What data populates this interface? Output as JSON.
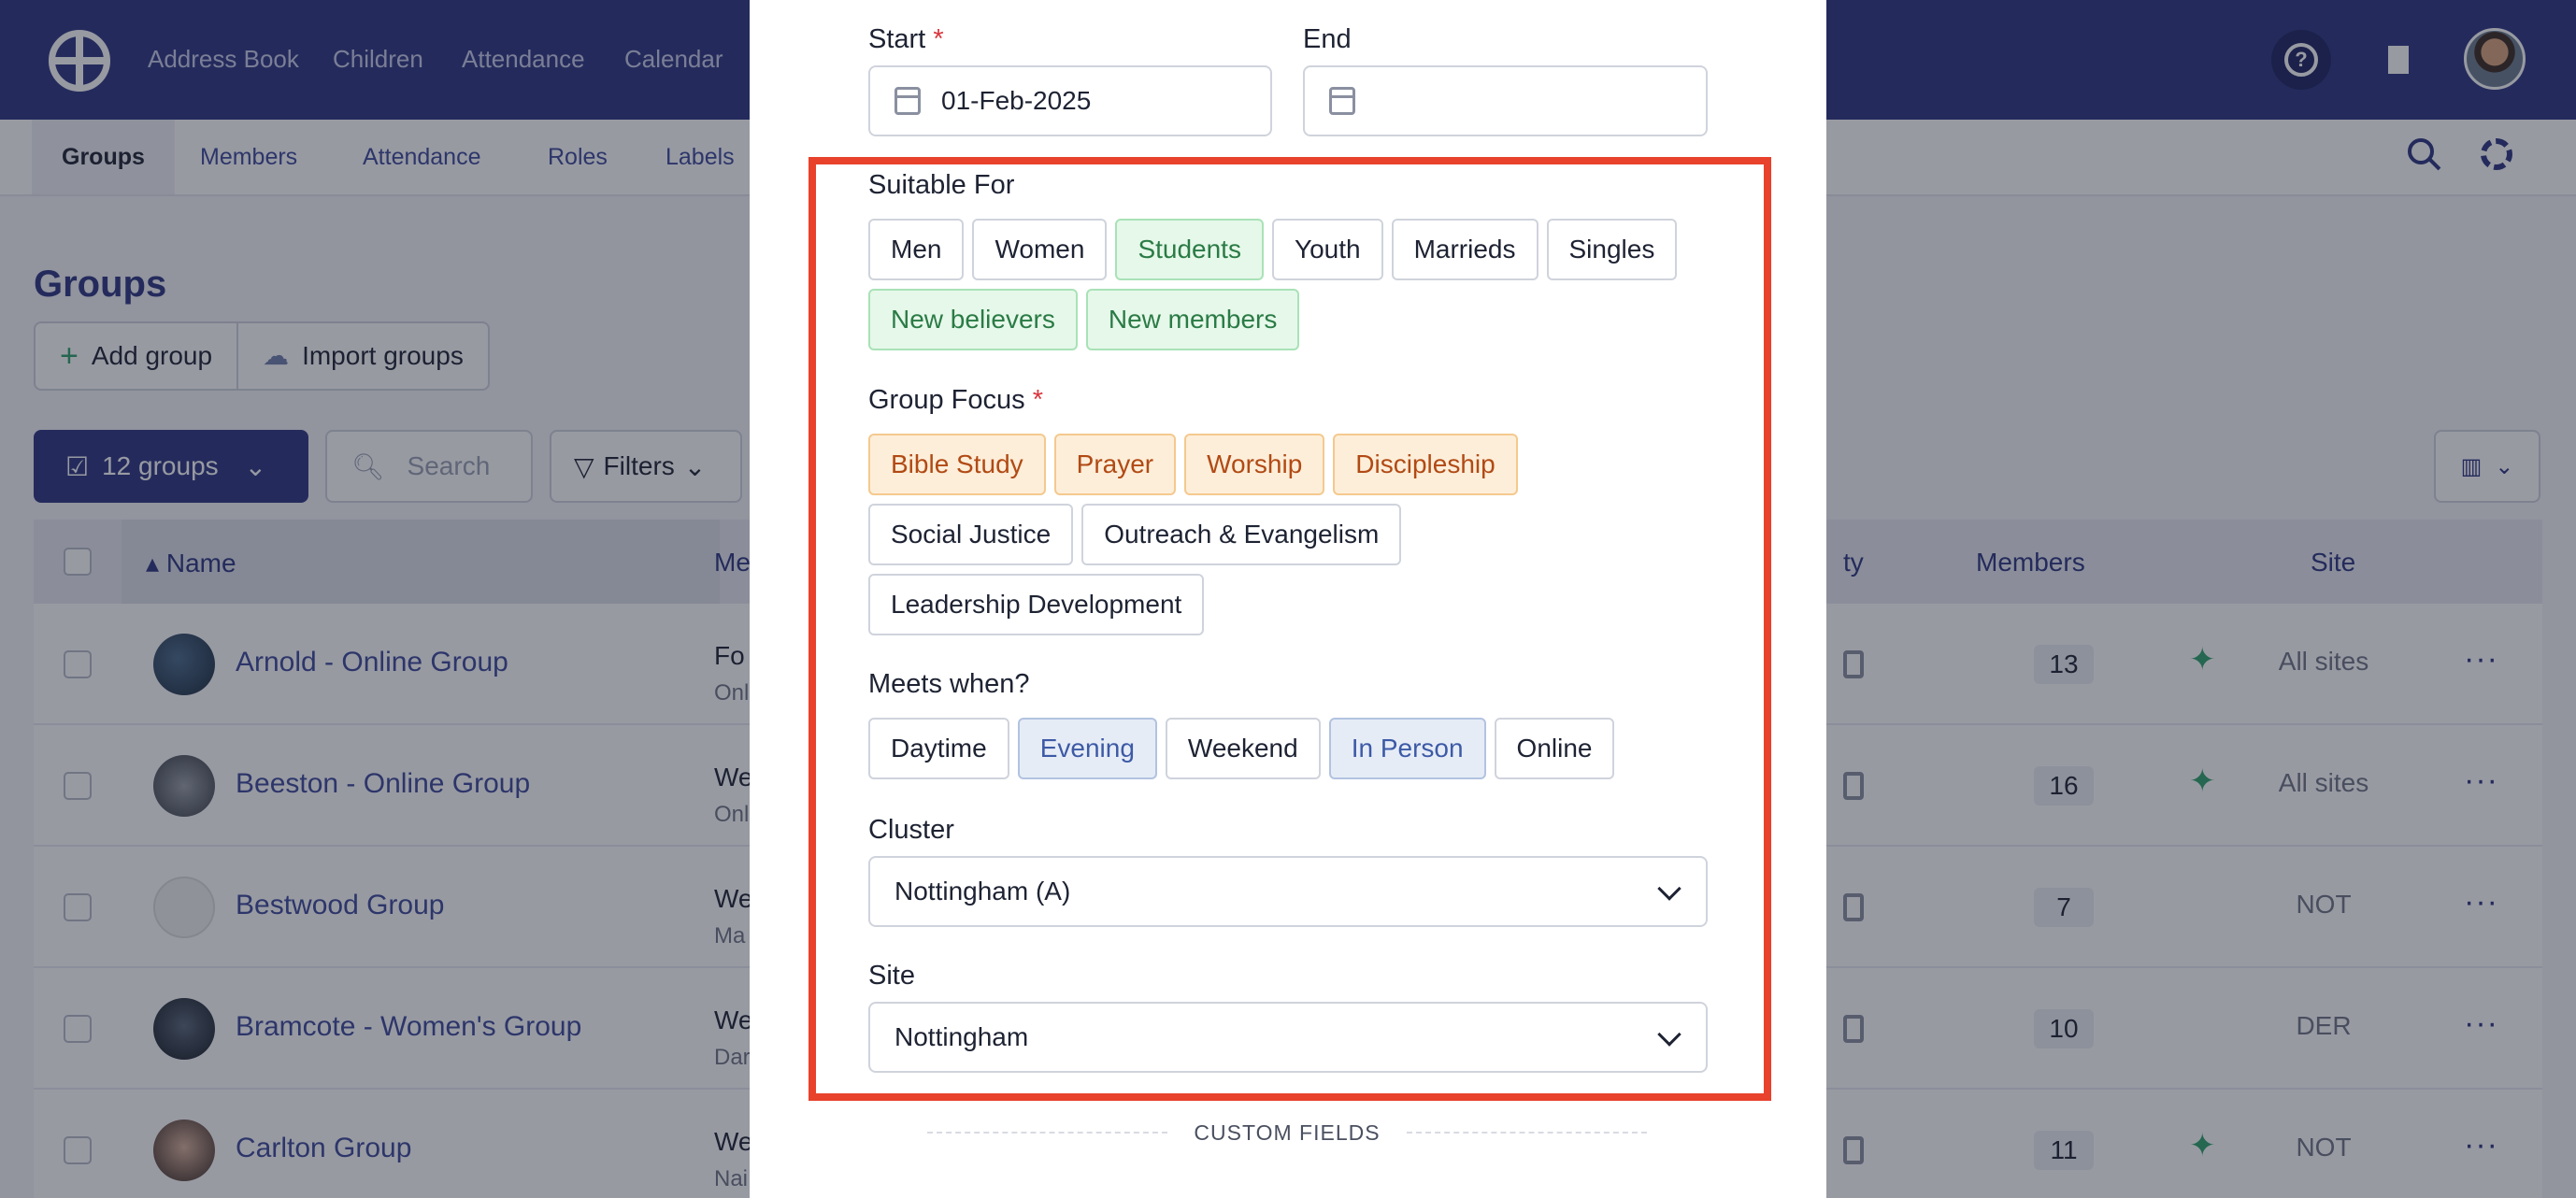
{
  "top_nav": {
    "links": [
      "Address Book",
      "Children",
      "Attendance",
      "Calendar"
    ]
  },
  "sub_nav": {
    "links": [
      "Groups",
      "Members",
      "Attendance",
      "Roles",
      "Labels"
    ],
    "active": "Groups"
  },
  "page": {
    "title": "Groups",
    "add_group_label": "Add group",
    "import_groups_label": "Import groups",
    "groups_count_label": "12 groups",
    "search_placeholder": "Search",
    "filters_label": "Filters"
  },
  "table": {
    "headers": {
      "name": "Name",
      "meets": "Me",
      "capacity": "ty",
      "members": "Members",
      "site": "Site"
    },
    "rows": [
      {
        "name": "Arnold - Online Group",
        "meta1": "Fo",
        "meta2": "Onl",
        "members": "13",
        "site": "All sites"
      },
      {
        "name": "Beeston - Online Group",
        "meta1": "We",
        "meta2": "Onl",
        "members": "16",
        "site": "All sites"
      },
      {
        "name": "Bestwood Group",
        "meta1": "We",
        "meta2": "Ma",
        "members": "7",
        "site": "NOT"
      },
      {
        "name": "Bramcote - Women's Group",
        "meta1": "We",
        "meta2": "Dar",
        "members": "10",
        "site": "DER"
      },
      {
        "name": "Carlton Group",
        "meta1": "We",
        "meta2": "Nai",
        "members": "11",
        "site": "NOT"
      }
    ]
  },
  "modal": {
    "start_label": "Start",
    "start_value": "01-Feb-2025",
    "end_label": "End",
    "end_value": "",
    "suitable_for": {
      "label": "Suitable For",
      "options": [
        "Men",
        "Women",
        "Students",
        "Youth",
        "Marrieds",
        "Singles",
        "New believers",
        "New members"
      ],
      "selected": [
        "Students",
        "New believers",
        "New members"
      ]
    },
    "group_focus": {
      "label": "Group Focus",
      "options": [
        "Bible Study",
        "Prayer",
        "Worship",
        "Discipleship",
        "Social Justice",
        "Outreach & Evangelism",
        "Leadership Development"
      ],
      "selected": [
        "Bible Study",
        "Prayer",
        "Worship",
        "Discipleship"
      ]
    },
    "meets_when": {
      "label": "Meets when?",
      "options": [
        "Daytime",
        "Evening",
        "Weekend",
        "In Person",
        "Online"
      ],
      "selected": [
        "Evening",
        "In Person"
      ]
    },
    "cluster": {
      "label": "Cluster",
      "value": "Nottingham (A)"
    },
    "site": {
      "label": "Site",
      "value": "Nottingham"
    },
    "custom_fields_label": "CUSTOM FIELDS",
    "required_mark": "*"
  },
  "colors": {
    "nav_bg": "#2c3580",
    "highlight_border": "#e8412c",
    "chip_green": "#e6f8ea",
    "chip_orange": "#fdeed9",
    "chip_blue": "#e6ecf6"
  }
}
